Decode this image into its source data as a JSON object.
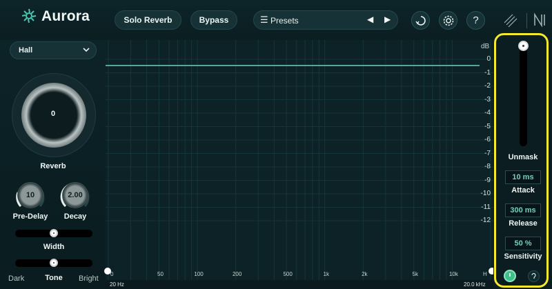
{
  "app": {
    "logo_text": "Aurora"
  },
  "toolbar": {
    "solo_reverb_label": "Solo Reverb",
    "bypass_label": "Bypass",
    "presets_label": "Presets",
    "icons": [
      "list-icon",
      "prev-arrow-icon",
      "next-arrow-icon",
      "history-icon",
      "gear-icon",
      "help-icon",
      "izotope-logo-icon",
      "ni-logo-icon"
    ]
  },
  "left": {
    "reverb_type": "Hall",
    "reverb_value": "0",
    "reverb_label": "Reverb",
    "predelay_value": "10",
    "predelay_label": "Pre-Delay",
    "decay_value": "2.00",
    "decay_label": "Decay",
    "width_label": "Width",
    "width_level": 0.5,
    "tone_label": "Tone",
    "tone_level": 0.5,
    "tone_left": "Dark",
    "tone_right": "Bright"
  },
  "graph": {
    "db_unit": "dB",
    "db_ticks": [
      "0",
      "-1",
      "-2",
      "-3",
      "-4",
      "-5",
      "-6",
      "-7",
      "-8",
      "-9",
      "-10",
      "-11",
      "-12"
    ],
    "freq_ticks": [
      "50",
      "100",
      "200",
      "500",
      "1k",
      "2k",
      "5k",
      "10k"
    ],
    "freq_start_partial": "0",
    "freq_end_partial": "H",
    "freq_min": "20 Hz",
    "freq_max": "20.0 kHz",
    "line_db": 0
  },
  "right": {
    "unmask_label": "Unmask",
    "unmask_level": 1.0,
    "attack_value": "10 ms",
    "attack_label": "Attack",
    "release_value": "300 ms",
    "release_label": "Release",
    "sensitivity_value": "50 %",
    "sensitivity_label": "Sensitivity"
  },
  "colors": {
    "accent": "#6fd0c3",
    "highlight": "#f5e82d",
    "active_green": "#3dbf8b"
  }
}
